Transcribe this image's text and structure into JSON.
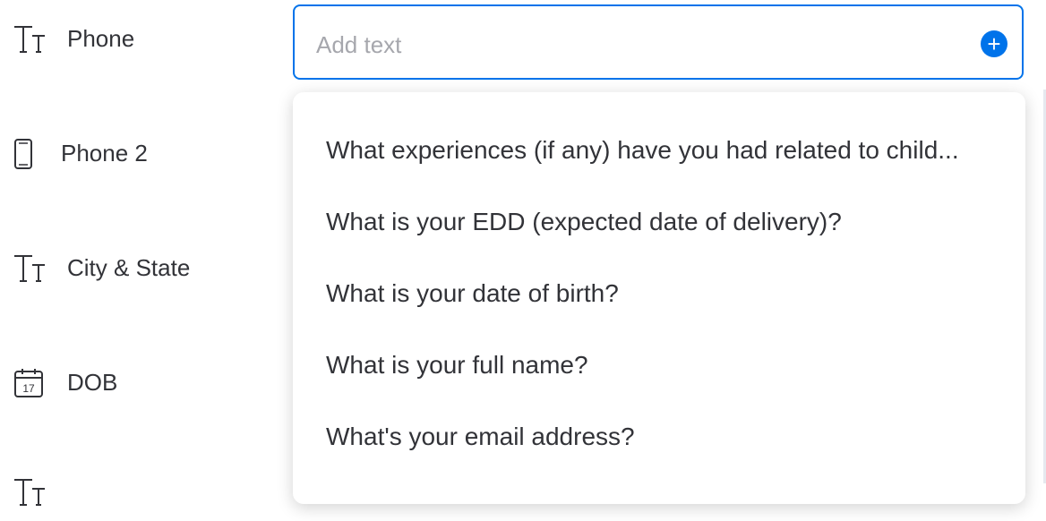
{
  "fields": [
    {
      "icon": "text-type-icon",
      "label": "Phone"
    },
    {
      "icon": "mobile-phone-icon",
      "label": "Phone 2"
    },
    {
      "icon": "text-type-icon",
      "label": "City & State"
    },
    {
      "icon": "calendar-icon",
      "label": "DOB",
      "icon_text": "17"
    },
    {
      "icon": "text-type-icon",
      "label": ""
    }
  ],
  "input": {
    "placeholder": "Add text",
    "value": ""
  },
  "add_button": {
    "icon": "plus-icon",
    "label": "+"
  },
  "dropdown": {
    "options": [
      "What experiences (if any) have you had related to child...",
      "What is your EDD (expected date of delivery)?",
      "What is your date of birth?",
      "What is your full name?",
      "What's your email address?"
    ]
  },
  "colors": {
    "accent": "#0073ea",
    "text": "#323338",
    "placeholder": "#a6a7ad"
  }
}
